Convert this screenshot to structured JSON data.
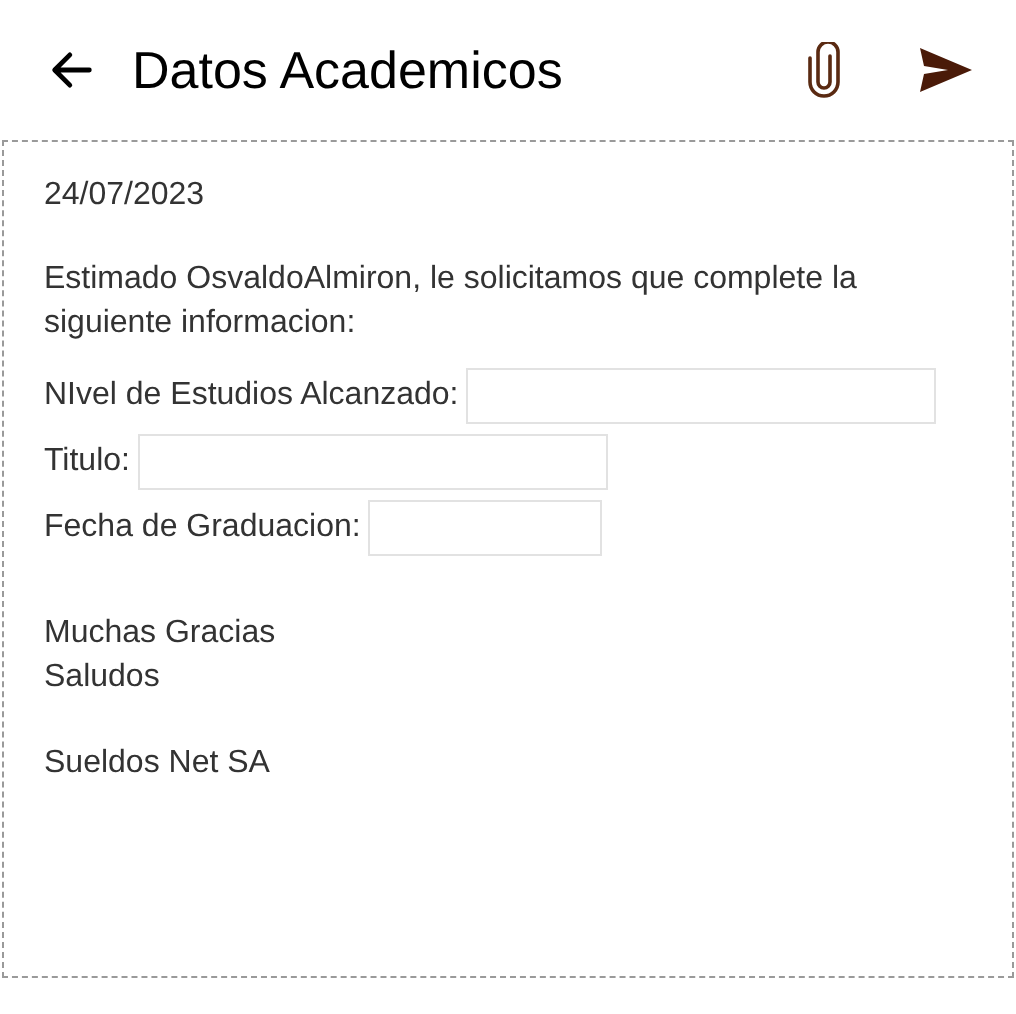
{
  "header": {
    "title": "Datos Academicos"
  },
  "message": {
    "date": "24/07/2023",
    "intro": "Estimado OsvaldoAlmiron, le solicitamos que complete la siguiente informacion:",
    "fields": [
      {
        "label": "NIvel de Estudios Alcanzado:",
        "kind": "wide"
      },
      {
        "label": "Titulo:",
        "kind": "wide"
      },
      {
        "label": "Fecha de Graduacion:",
        "kind": "narrow"
      }
    ],
    "closing": [
      "Muchas Gracias",
      "Saludos"
    ],
    "signature": "Sueldos Net SA"
  }
}
